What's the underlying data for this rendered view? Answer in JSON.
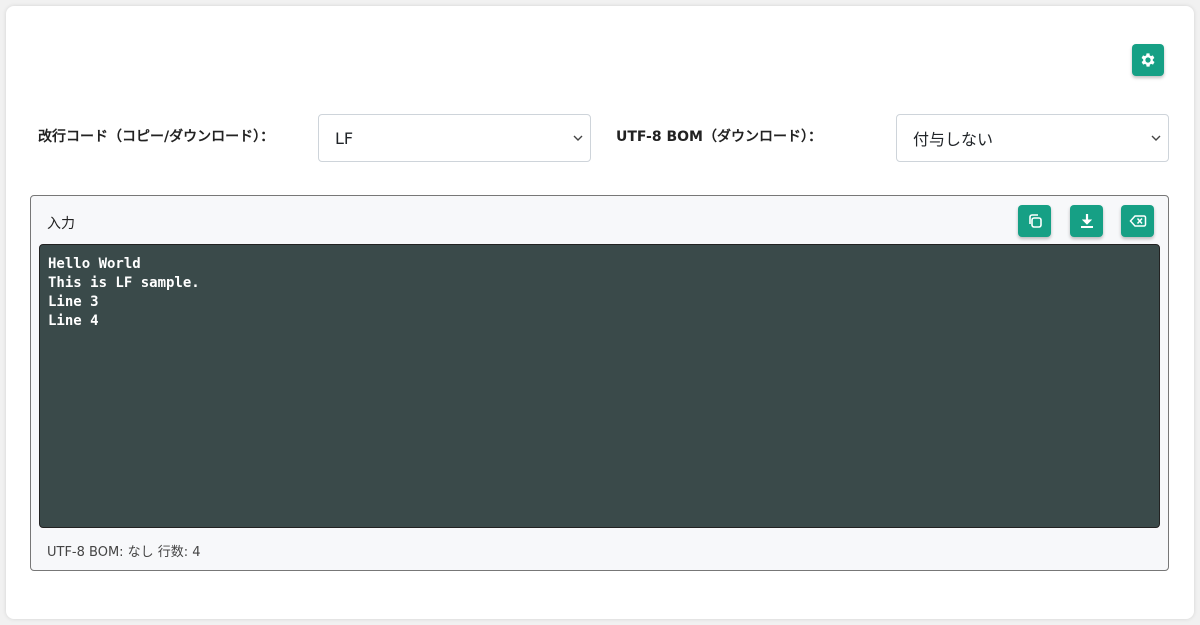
{
  "toolbar": {
    "settings_icon": "gear-icon",
    "accent_color": "#16a085"
  },
  "options": {
    "newline_label": "改行コード（コピー/ダウンロード）：",
    "newline_value": "LF",
    "bom_label": "UTF-8 BOM（ダウンロード）：",
    "bom_value": "付与しない"
  },
  "panel": {
    "title": "入力",
    "buttons": [
      "copy-icon",
      "download-icon",
      "clear-icon"
    ],
    "lines": [
      "Hello World",
      "This is LF sample.",
      "Line 3",
      "Line 4"
    ],
    "status": {
      "bom": "UTF-8 BOM: なし",
      "line_count": "行数: 4"
    }
  }
}
